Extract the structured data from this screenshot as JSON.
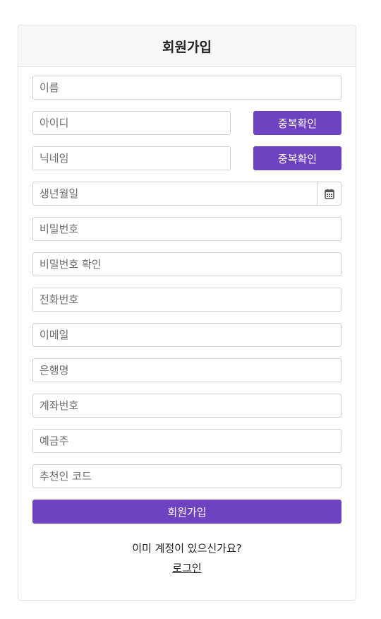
{
  "header": {
    "title": "회원가입"
  },
  "form": {
    "name_placeholder": "이름",
    "id_placeholder": "아이디",
    "id_check_label": "중복확인",
    "nickname_placeholder": "닉네임",
    "nickname_check_label": "중복확인",
    "birthdate_placeholder": "생년월일",
    "password_placeholder": "비밀번호",
    "password_confirm_placeholder": "비밀번호 확인",
    "phone_placeholder": "전화번호",
    "email_placeholder": "이메일",
    "bank_placeholder": "은행명",
    "account_placeholder": "계좌번호",
    "holder_placeholder": "예금주",
    "referral_placeholder": "추천인 코드",
    "submit_label": "회원가입"
  },
  "footer": {
    "question": "이미 계정이 있으신가요?",
    "login_link": "로그인"
  },
  "colors": {
    "accent": "#6f42c1",
    "header_bg": "#f7f7f7"
  },
  "icons": {
    "calendar": "calendar-icon"
  }
}
